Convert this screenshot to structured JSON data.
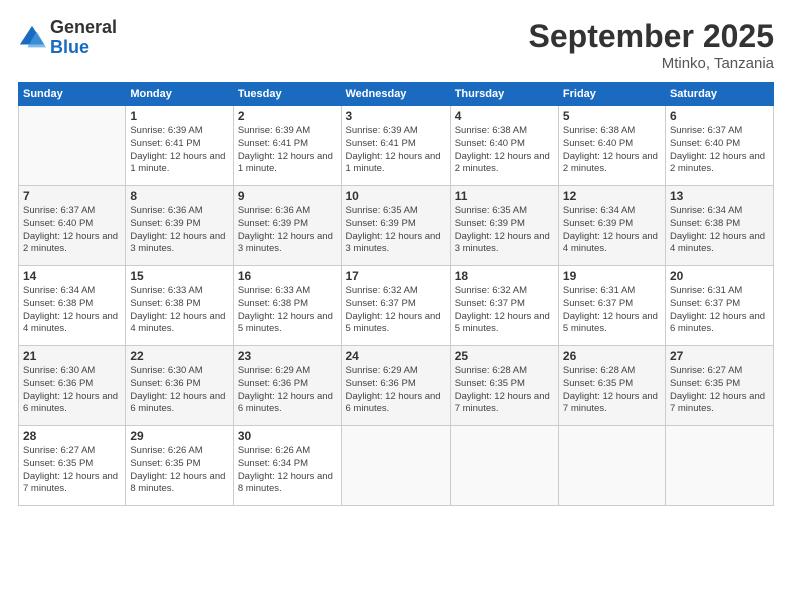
{
  "header": {
    "logo": {
      "general": "General",
      "blue": "Blue"
    },
    "title": "September 2025",
    "location": "Mtinko, Tanzania"
  },
  "weekdays": [
    "Sunday",
    "Monday",
    "Tuesday",
    "Wednesday",
    "Thursday",
    "Friday",
    "Saturday"
  ],
  "weeks": [
    [
      null,
      {
        "day": 1,
        "sunrise": "6:39 AM",
        "sunset": "6:41 PM",
        "daylight": "12 hours and 1 minute."
      },
      {
        "day": 2,
        "sunrise": "6:39 AM",
        "sunset": "6:41 PM",
        "daylight": "12 hours and 1 minute."
      },
      {
        "day": 3,
        "sunrise": "6:39 AM",
        "sunset": "6:41 PM",
        "daylight": "12 hours and 1 minute."
      },
      {
        "day": 4,
        "sunrise": "6:38 AM",
        "sunset": "6:40 PM",
        "daylight": "12 hours and 2 minutes."
      },
      {
        "day": 5,
        "sunrise": "6:38 AM",
        "sunset": "6:40 PM",
        "daylight": "12 hours and 2 minutes."
      },
      {
        "day": 6,
        "sunrise": "6:37 AM",
        "sunset": "6:40 PM",
        "daylight": "12 hours and 2 minutes."
      }
    ],
    [
      {
        "day": 7,
        "sunrise": "6:37 AM",
        "sunset": "6:40 PM",
        "daylight": "12 hours and 2 minutes."
      },
      {
        "day": 8,
        "sunrise": "6:36 AM",
        "sunset": "6:39 PM",
        "daylight": "12 hours and 3 minutes."
      },
      {
        "day": 9,
        "sunrise": "6:36 AM",
        "sunset": "6:39 PM",
        "daylight": "12 hours and 3 minutes."
      },
      {
        "day": 10,
        "sunrise": "6:35 AM",
        "sunset": "6:39 PM",
        "daylight": "12 hours and 3 minutes."
      },
      {
        "day": 11,
        "sunrise": "6:35 AM",
        "sunset": "6:39 PM",
        "daylight": "12 hours and 3 minutes."
      },
      {
        "day": 12,
        "sunrise": "6:34 AM",
        "sunset": "6:39 PM",
        "daylight": "12 hours and 4 minutes."
      },
      {
        "day": 13,
        "sunrise": "6:34 AM",
        "sunset": "6:38 PM",
        "daylight": "12 hours and 4 minutes."
      }
    ],
    [
      {
        "day": 14,
        "sunrise": "6:34 AM",
        "sunset": "6:38 PM",
        "daylight": "12 hours and 4 minutes."
      },
      {
        "day": 15,
        "sunrise": "6:33 AM",
        "sunset": "6:38 PM",
        "daylight": "12 hours and 4 minutes."
      },
      {
        "day": 16,
        "sunrise": "6:33 AM",
        "sunset": "6:38 PM",
        "daylight": "12 hours and 5 minutes."
      },
      {
        "day": 17,
        "sunrise": "6:32 AM",
        "sunset": "6:37 PM",
        "daylight": "12 hours and 5 minutes."
      },
      {
        "day": 18,
        "sunrise": "6:32 AM",
        "sunset": "6:37 PM",
        "daylight": "12 hours and 5 minutes."
      },
      {
        "day": 19,
        "sunrise": "6:31 AM",
        "sunset": "6:37 PM",
        "daylight": "12 hours and 5 minutes."
      },
      {
        "day": 20,
        "sunrise": "6:31 AM",
        "sunset": "6:37 PM",
        "daylight": "12 hours and 6 minutes."
      }
    ],
    [
      {
        "day": 21,
        "sunrise": "6:30 AM",
        "sunset": "6:36 PM",
        "daylight": "12 hours and 6 minutes."
      },
      {
        "day": 22,
        "sunrise": "6:30 AM",
        "sunset": "6:36 PM",
        "daylight": "12 hours and 6 minutes."
      },
      {
        "day": 23,
        "sunrise": "6:29 AM",
        "sunset": "6:36 PM",
        "daylight": "12 hours and 6 minutes."
      },
      {
        "day": 24,
        "sunrise": "6:29 AM",
        "sunset": "6:36 PM",
        "daylight": "12 hours and 6 minutes."
      },
      {
        "day": 25,
        "sunrise": "6:28 AM",
        "sunset": "6:35 PM",
        "daylight": "12 hours and 7 minutes."
      },
      {
        "day": 26,
        "sunrise": "6:28 AM",
        "sunset": "6:35 PM",
        "daylight": "12 hours and 7 minutes."
      },
      {
        "day": 27,
        "sunrise": "6:27 AM",
        "sunset": "6:35 PM",
        "daylight": "12 hours and 7 minutes."
      }
    ],
    [
      {
        "day": 28,
        "sunrise": "6:27 AM",
        "sunset": "6:35 PM",
        "daylight": "12 hours and 7 minutes."
      },
      {
        "day": 29,
        "sunrise": "6:26 AM",
        "sunset": "6:35 PM",
        "daylight": "12 hours and 8 minutes."
      },
      {
        "day": 30,
        "sunrise": "6:26 AM",
        "sunset": "6:34 PM",
        "daylight": "12 hours and 8 minutes."
      },
      null,
      null,
      null,
      null
    ]
  ]
}
